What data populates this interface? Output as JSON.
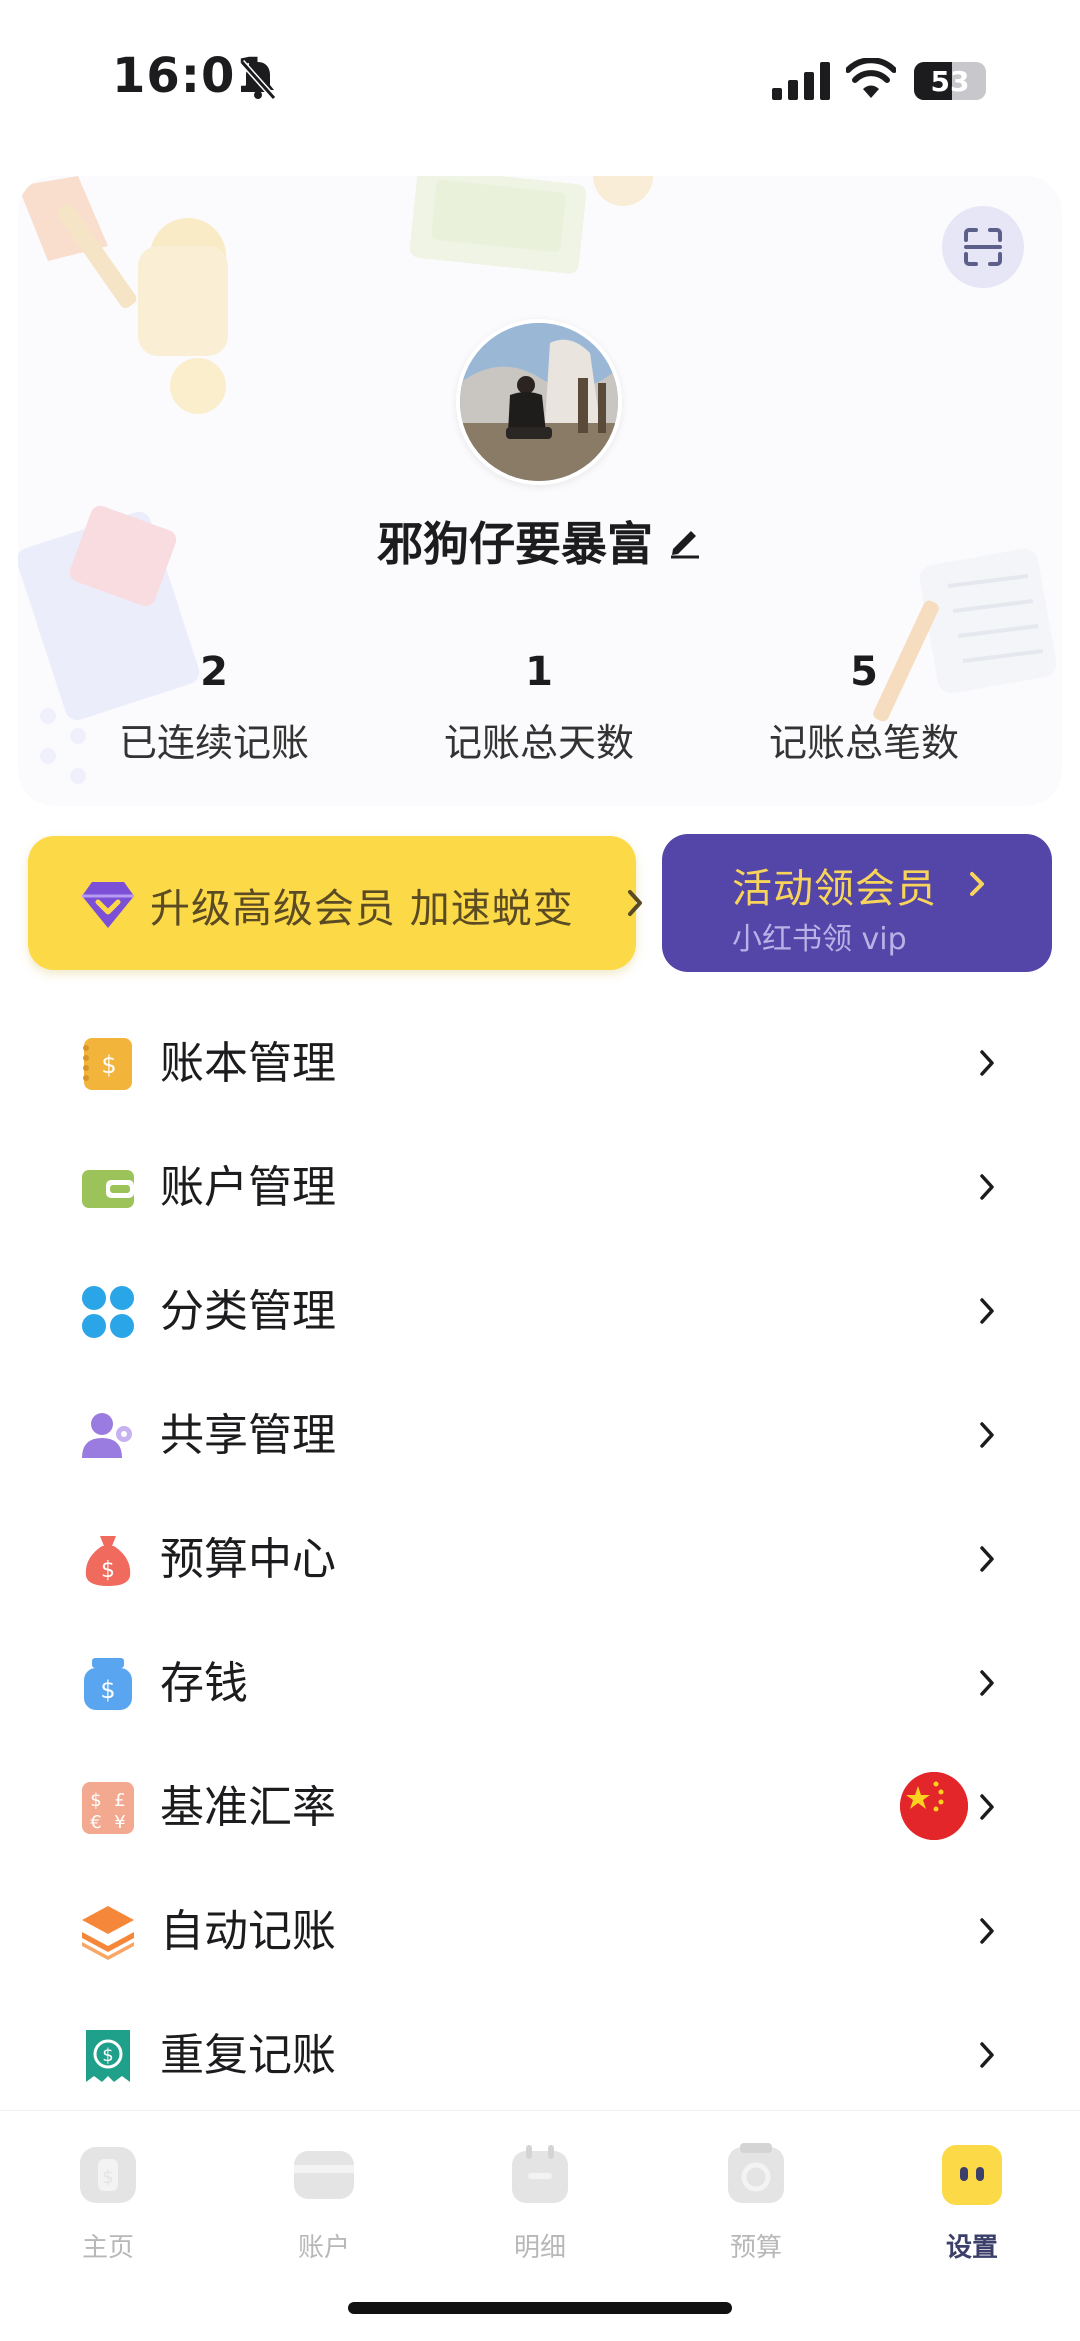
{
  "status_bar": {
    "time": "16:01",
    "battery": "53",
    "battery_fraction": 0.53
  },
  "profile": {
    "username": "邪狗仔要暴富",
    "stats": [
      {
        "value": "2",
        "label": "已连续记账"
      },
      {
        "value": "1",
        "label": "记账总天数"
      },
      {
        "value": "5",
        "label": "记账总笔数"
      }
    ]
  },
  "promo": {
    "upgrade_label": "升级高级会员 加速蜕变",
    "vip_title": "活动领会员",
    "vip_subtitle": "小红书领 vip"
  },
  "menu": {
    "items": [
      {
        "label": "账本管理",
        "icon": "ledger-icon"
      },
      {
        "label": "账户管理",
        "icon": "wallet-icon"
      },
      {
        "label": "分类管理",
        "icon": "category-icon"
      },
      {
        "label": "共享管理",
        "icon": "share-users-icon"
      },
      {
        "label": "预算中心",
        "icon": "money-bag-icon"
      },
      {
        "label": "存钱",
        "icon": "savings-jar-icon"
      },
      {
        "label": "基准汇率",
        "icon": "exchange-rate-icon"
      },
      {
        "label": "自动记账",
        "icon": "layers-icon"
      },
      {
        "label": "重复记账",
        "icon": "repeat-bill-icon"
      }
    ]
  },
  "tabs": [
    {
      "label": "主页",
      "icon": "home-icon"
    },
    {
      "label": "账户",
      "icon": "account-wallet-icon"
    },
    {
      "label": "明细",
      "icon": "calendar-icon"
    },
    {
      "label": "预算",
      "icon": "budget-icon"
    },
    {
      "label": "设置",
      "icon": "settings-face-icon",
      "active": true
    }
  ],
  "colors": {
    "accent_yellow": "#fcd947",
    "accent_purple": "#5446a8",
    "vip_gold_text": "#f8d55a",
    "active_tab": "#3b3f6a",
    "inactive_tab": "#b8b8b8"
  }
}
